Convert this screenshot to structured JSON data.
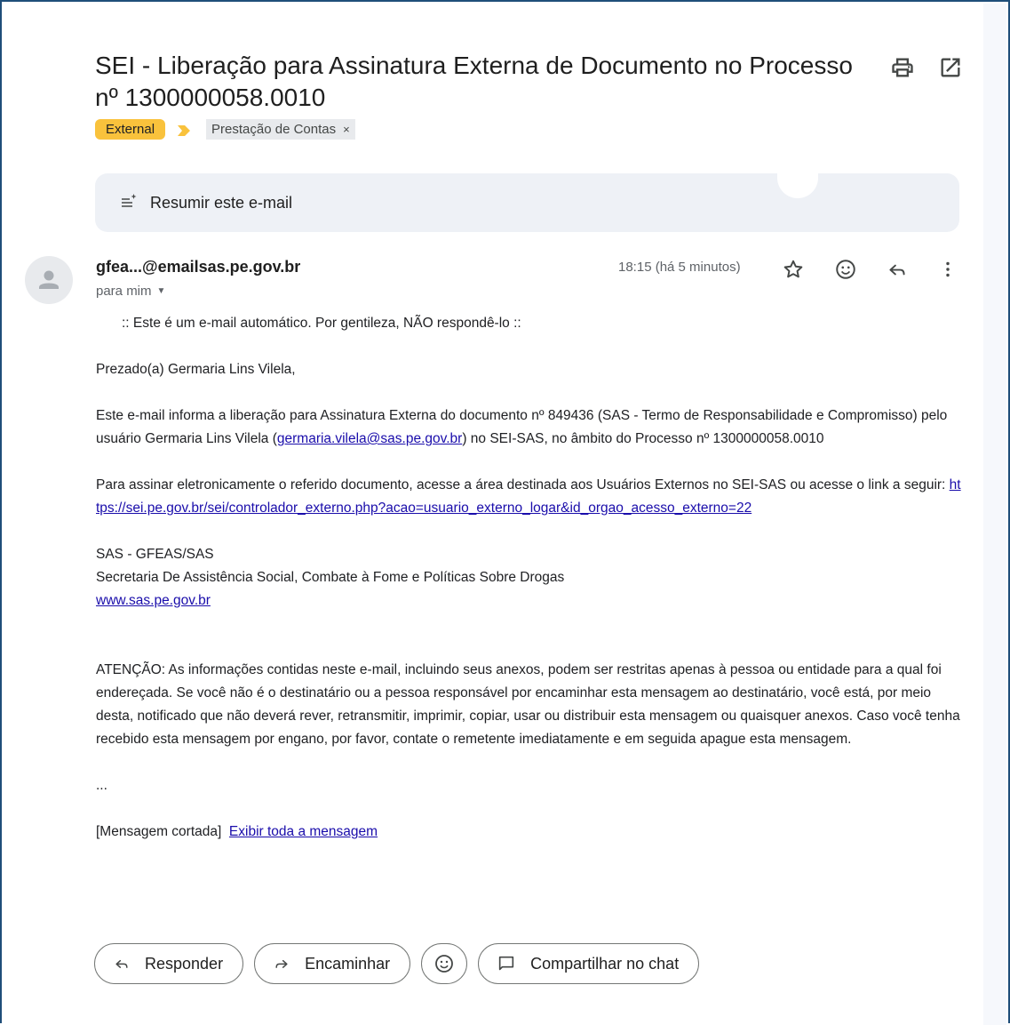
{
  "email": {
    "subject": "SEI - Liberação para Assinatura Externa de Documento no Processo nº 1300000058.0010",
    "labels": {
      "external": "External",
      "user_label": "Prestação de Contas",
      "remove_symbol": "×"
    },
    "summarize_label": "Resumir este e-mail",
    "sender": "gfea...@emailsas.pe.gov.br",
    "recipient": "para mim",
    "timestamp": "18:15 (há 5 minutos)",
    "body": {
      "auto_note": ":: Este é um e-mail automático. Por gentileza, NÃO respondê-lo ::",
      "greeting": "Prezado(a) Germaria Lins Vilela,",
      "p1_before": "Este e-mail informa a liberação para Assinatura Externa do documento nº 849436    (SAS - Termo de Responsabilidade e Compromisso) pelo usuário Germaria Lins Vilela (",
      "p1_email": "germaria.vilela@sas.pe.gov.br",
      "p1_after": ") no SEI-SAS, no âmbito do Processo nº 1300000058.0010",
      "p2_before": "Para assinar eletronicamente o referido documento, acesse a área destinada aos Usuários Externos no SEI-SAS ou acesse o link a seguir: ",
      "p2_link": "https://sei.pe.gov.br/sei/controlador_externo.php?acao=usuario_externo_logar&id_orgao_acesso_externo=22",
      "sig_line1": "SAS - GFEAS/SAS",
      "sig_line2": "Secretaria De Assistência Social, Combate à Fome e Políticas Sobre Drogas",
      "sig_link": "www.sas.pe.gov.br",
      "notice": "ATENÇÃO: As informações contidas neste e-mail, incluindo seus anexos, podem ser restritas apenas à pessoa ou entidade para a qual foi endereçada. Se você não é o destinatário ou a pessoa responsável por encaminhar esta mensagem ao destinatário, você está, por meio desta, notificado que não deverá rever, retransmitir, imprimir, copiar, usar ou distribuir esta mensagem ou quaisquer anexos. Caso você tenha recebido esta mensagem por engano, por favor, contate o remetente imediatamente e em seguida apague esta mensagem.",
      "ellipsis": "...",
      "clipped_label": "[Mensagem cortada]",
      "clipped_link": "Exibir toda a mensagem"
    },
    "actions": {
      "reply": "Responder",
      "forward": "Encaminhar",
      "share_chat": "Compartilhar no chat"
    }
  },
  "icons": [
    "print-icon",
    "open-in-new-window-icon",
    "label-arrow-icon",
    "summarize-icon",
    "avatar-person-icon",
    "star-icon",
    "emoji-icon",
    "reply-icon",
    "more-vert-icon",
    "forward-icon",
    "chat-icon"
  ],
  "colors": {
    "external_label": "#f9c23c",
    "label_arrow": "#f9c23c",
    "user_label_bg": "#e8eaed",
    "link": "#1a0dab",
    "summarize_bg": "#eef1f6",
    "frame_border": "#1f4e79"
  }
}
